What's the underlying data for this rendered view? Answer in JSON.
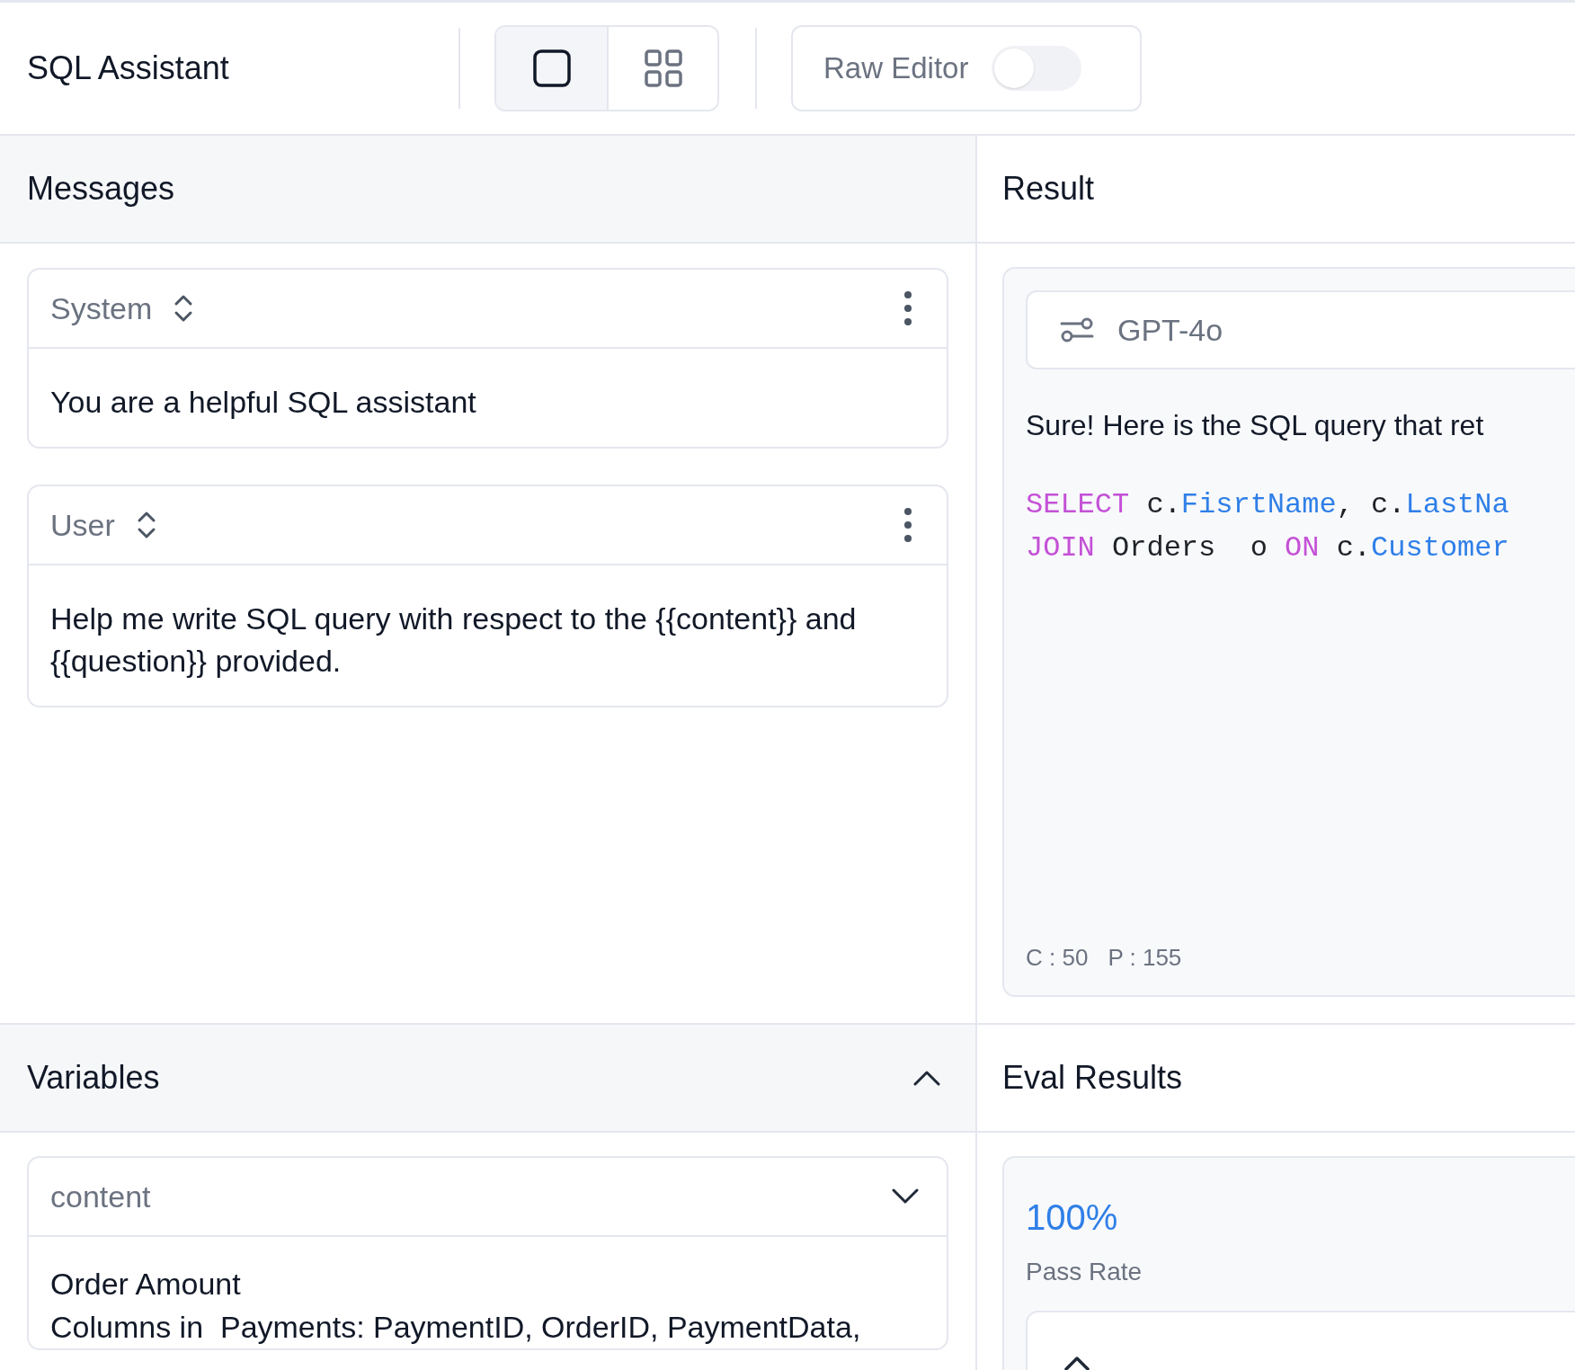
{
  "header": {
    "title": "SQL Assistant",
    "view_modes": [
      {
        "kind": "single",
        "selected": true
      },
      {
        "kind": "grid",
        "selected": false
      }
    ],
    "raw_editor": {
      "label": "Raw Editor",
      "on": false
    }
  },
  "messages": {
    "title": "Messages",
    "items": [
      {
        "role": "System",
        "content": "You are a helpful SQL assistant"
      },
      {
        "role": "User",
        "content": "Help me write SQL query with respect to the {{content}} and {{question}} provided."
      }
    ]
  },
  "variables": {
    "title": "Variables",
    "expanded": true,
    "items": [
      {
        "name": "content",
        "lines": [
          "Order Amount",
          "Columns in  Payments: PaymentID, OrderID, PaymentData,"
        ]
      }
    ]
  },
  "result": {
    "title": "Result",
    "model": "GPT-4o",
    "text": "Sure! Here is the SQL query that ret",
    "code": [
      [
        {
          "kind": "keyword",
          "text": "SELECT"
        },
        {
          "kind": "plain",
          "text": " c."
        },
        {
          "kind": "field",
          "text": "FisrtName"
        },
        {
          "kind": "plain",
          "text": ", c."
        },
        {
          "kind": "field",
          "text": "LastNa"
        }
      ],
      [
        {
          "kind": "keyword",
          "text": "JOIN"
        },
        {
          "kind": "plain",
          "text": " Orders  o "
        },
        {
          "kind": "keyword",
          "text": "ON"
        },
        {
          "kind": "plain",
          "text": " c."
        },
        {
          "kind": "field",
          "text": "Customer"
        }
      ]
    ],
    "stats": [
      "C : 50",
      "P : 155"
    ]
  },
  "eval_results": {
    "title": "Eval Results",
    "pass_rate": "100%",
    "pass_rate_label": "Pass Rate"
  }
}
